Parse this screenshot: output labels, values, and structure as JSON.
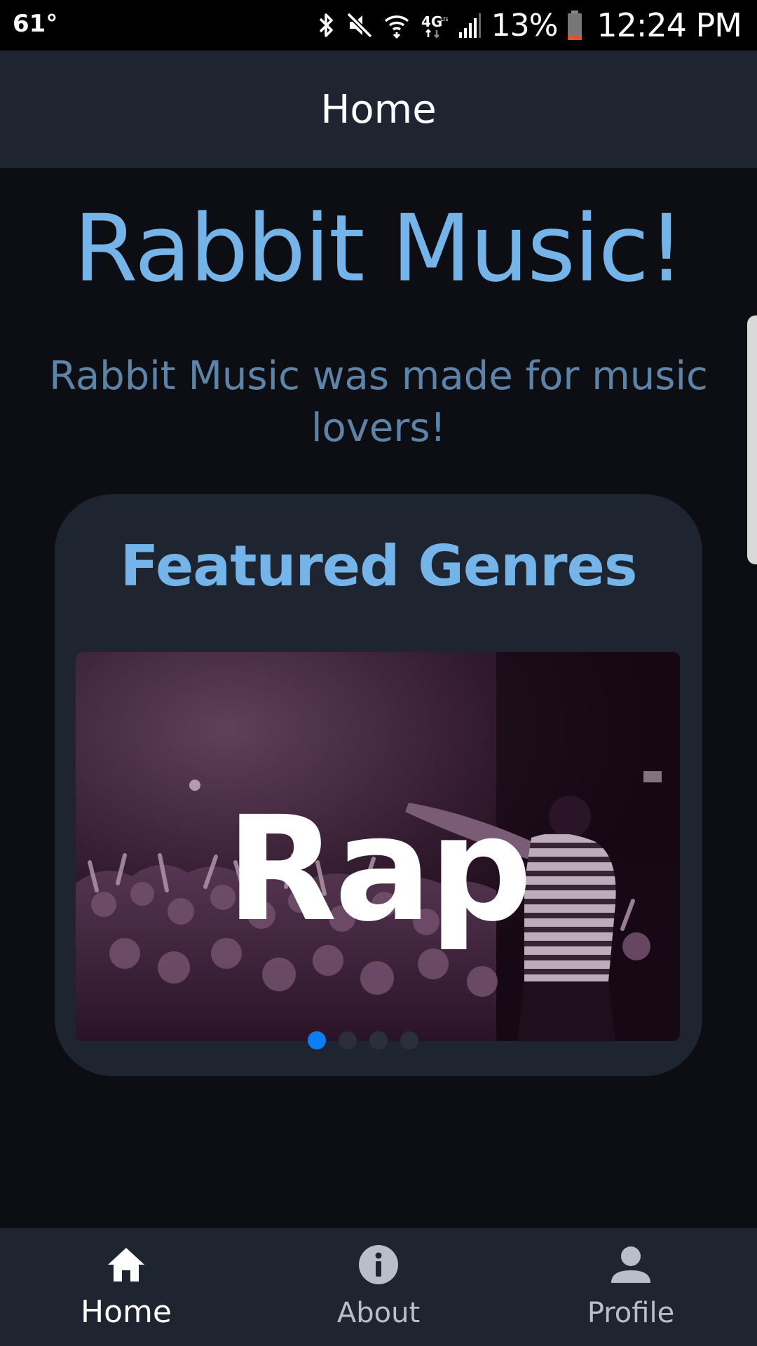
{
  "status_bar": {
    "temperature": "61°",
    "battery_percent": "13%",
    "time": "12:24 PM",
    "icons": [
      "bluetooth-icon",
      "mute-icon",
      "wifi-icon",
      "4g-lte-icon",
      "signal-icon",
      "battery-icon"
    ]
  },
  "header": {
    "title": "Home"
  },
  "main": {
    "app_title": "Rabbit Music!",
    "subtitle": "Rabbit Music was made for music lovers!",
    "featured": {
      "title": "Featured Genres",
      "slides": [
        {
          "label": "Rap",
          "image": "concert-crowd-performer"
        }
      ],
      "active_slide": 1,
      "slide_count": 4
    }
  },
  "bottom_nav": {
    "items": [
      {
        "label": "Home",
        "icon": "home-icon",
        "active": true
      },
      {
        "label": "About",
        "icon": "info-icon",
        "active": false
      },
      {
        "label": "Profile",
        "icon": "person-icon",
        "active": false
      }
    ]
  },
  "colors": {
    "accent": "#74b4e8",
    "subtitle": "#5d84a8",
    "surface": "#1f2530",
    "background": "#0c0e13",
    "dot_active": "#0d7ef2"
  }
}
